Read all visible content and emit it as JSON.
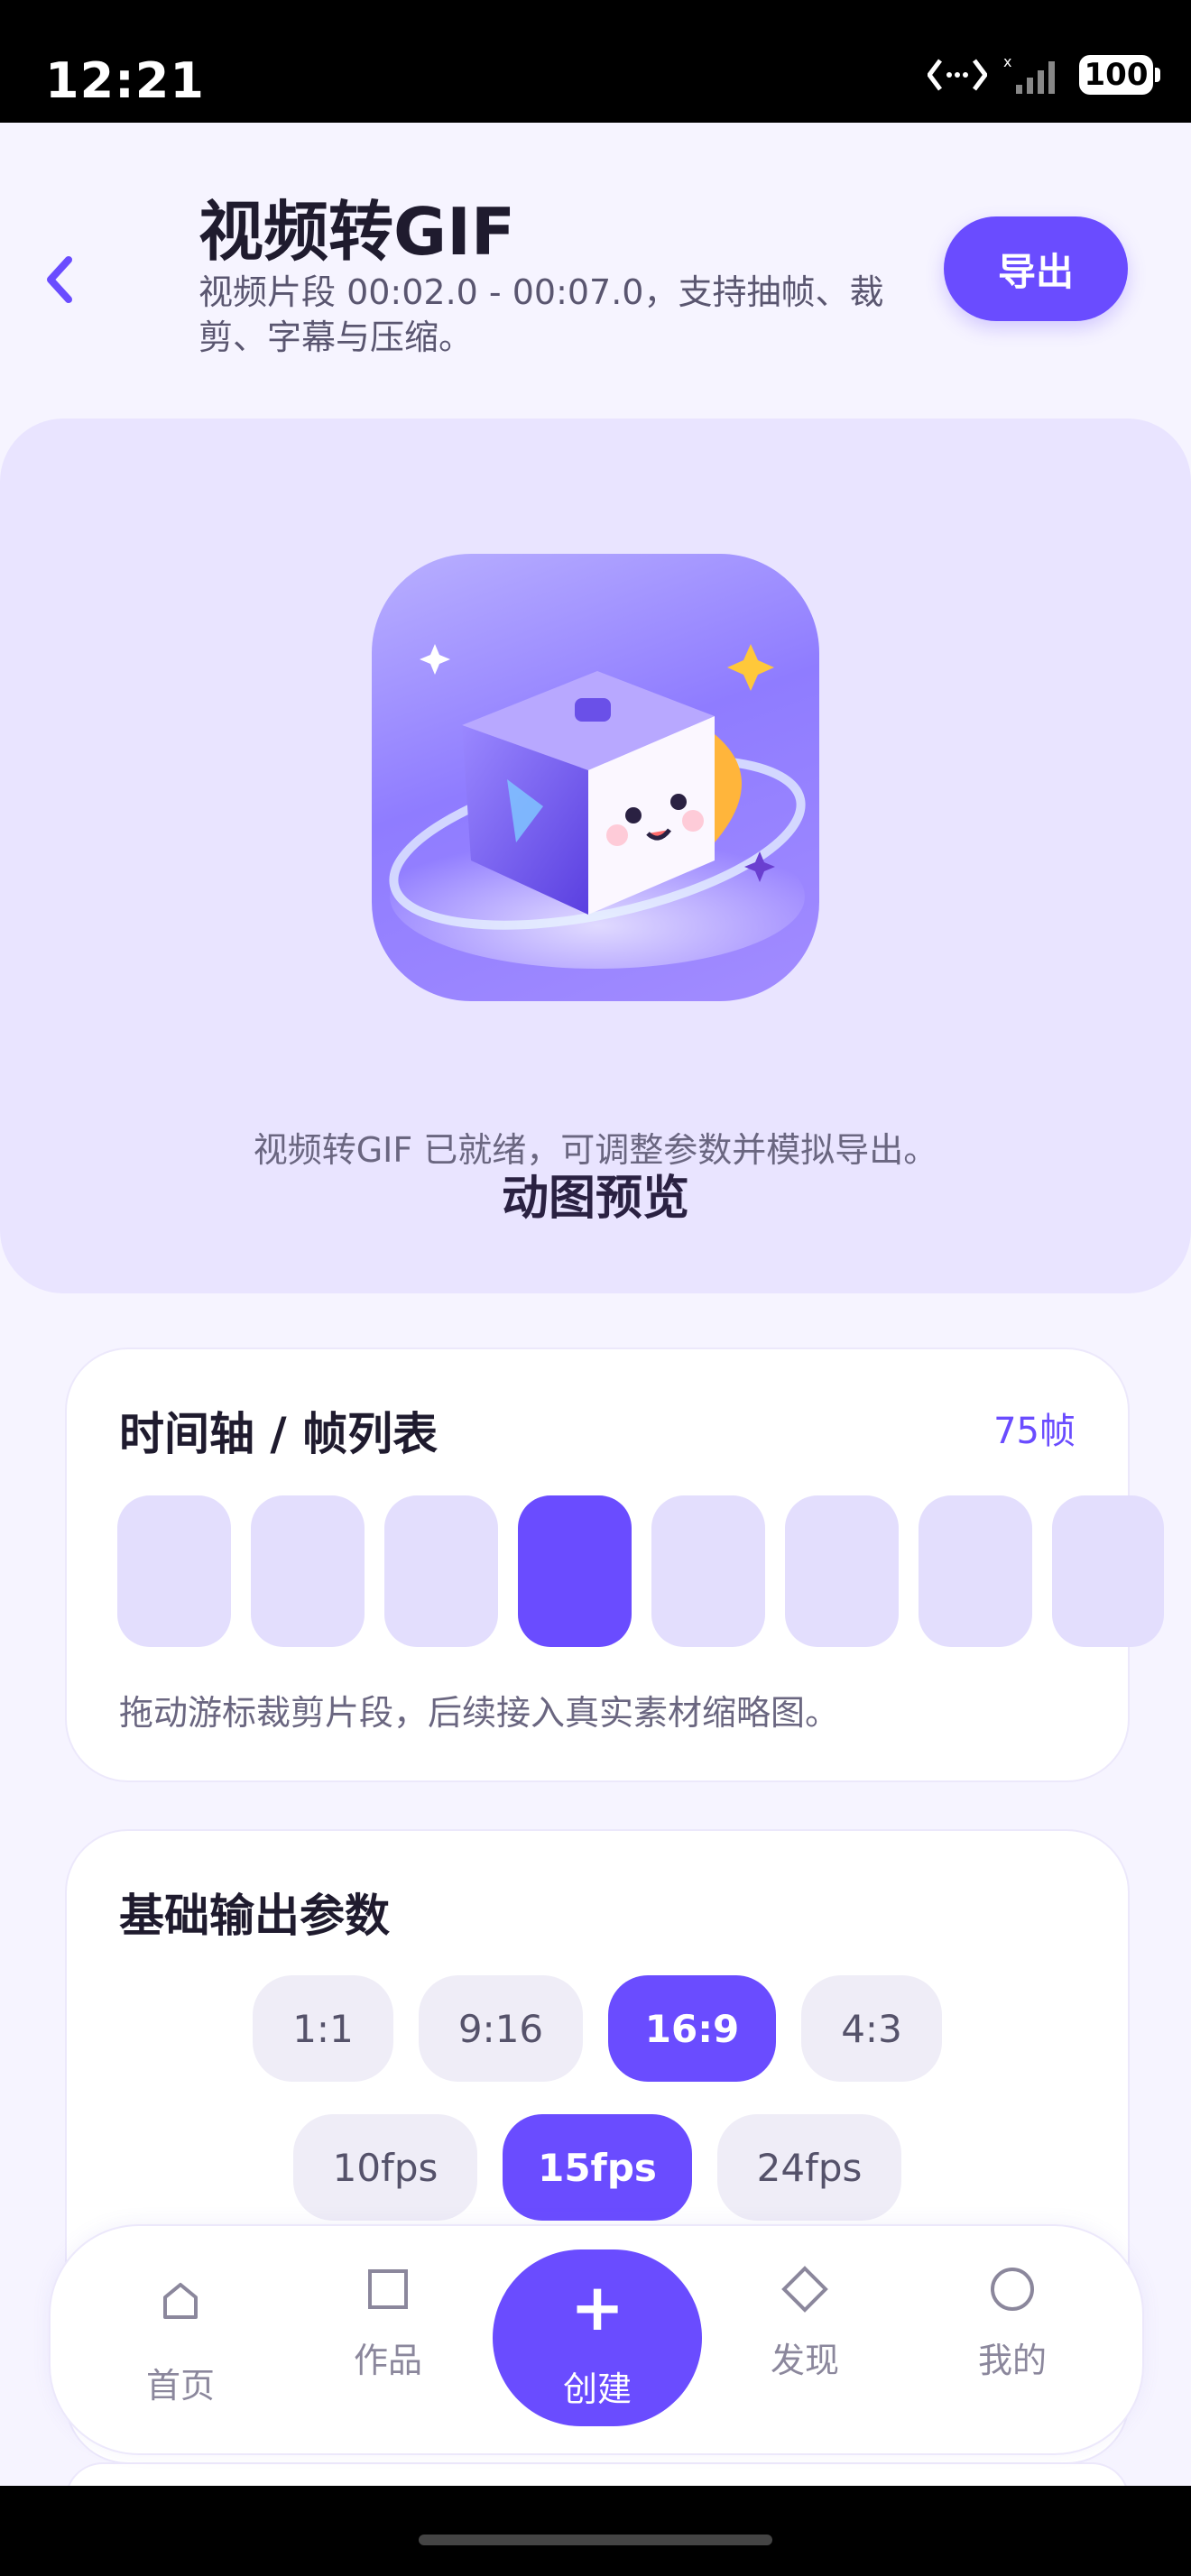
{
  "status_bar": {
    "time": "12:21",
    "battery": "100"
  },
  "header": {
    "title": "视频转GIF",
    "subtitle": "视频片段 00:02.0 - 00:07.0，支持抽帧、裁剪、字幕与压缩。",
    "export_label": "导出"
  },
  "preview": {
    "title": "动图预览",
    "description": "视频转GIF 已就绪，可调整参数并模拟导出。"
  },
  "timeline": {
    "title": "时间轴 / 帧列表",
    "frame_count": "75帧",
    "selected_frame_index": 3,
    "visible_frames": 8,
    "note": "拖动游标裁剪片段，后续接入真实素材缩略图。"
  },
  "output_params": {
    "title": "基础输出参数",
    "aspect_ratios": [
      "1:1",
      "9:16",
      "16:9",
      "4:3"
    ],
    "selected_aspect": "16:9",
    "frame_rates": [
      "10fps",
      "15fps",
      "24fps"
    ],
    "selected_fps": "15fps"
  },
  "tab_bar": {
    "items": [
      {
        "label": "首页",
        "icon": "home-icon"
      },
      {
        "label": "作品",
        "icon": "square-icon"
      },
      {
        "label": "创建",
        "icon": "plus-icon"
      },
      {
        "label": "发现",
        "icon": "diamond-icon"
      },
      {
        "label": "我的",
        "icon": "circle-icon"
      }
    ]
  },
  "colors": {
    "accent": "#6a4cff",
    "background": "#f6f4ff",
    "preview_bg": "#e9e4ff",
    "frame": "#e3defd"
  }
}
